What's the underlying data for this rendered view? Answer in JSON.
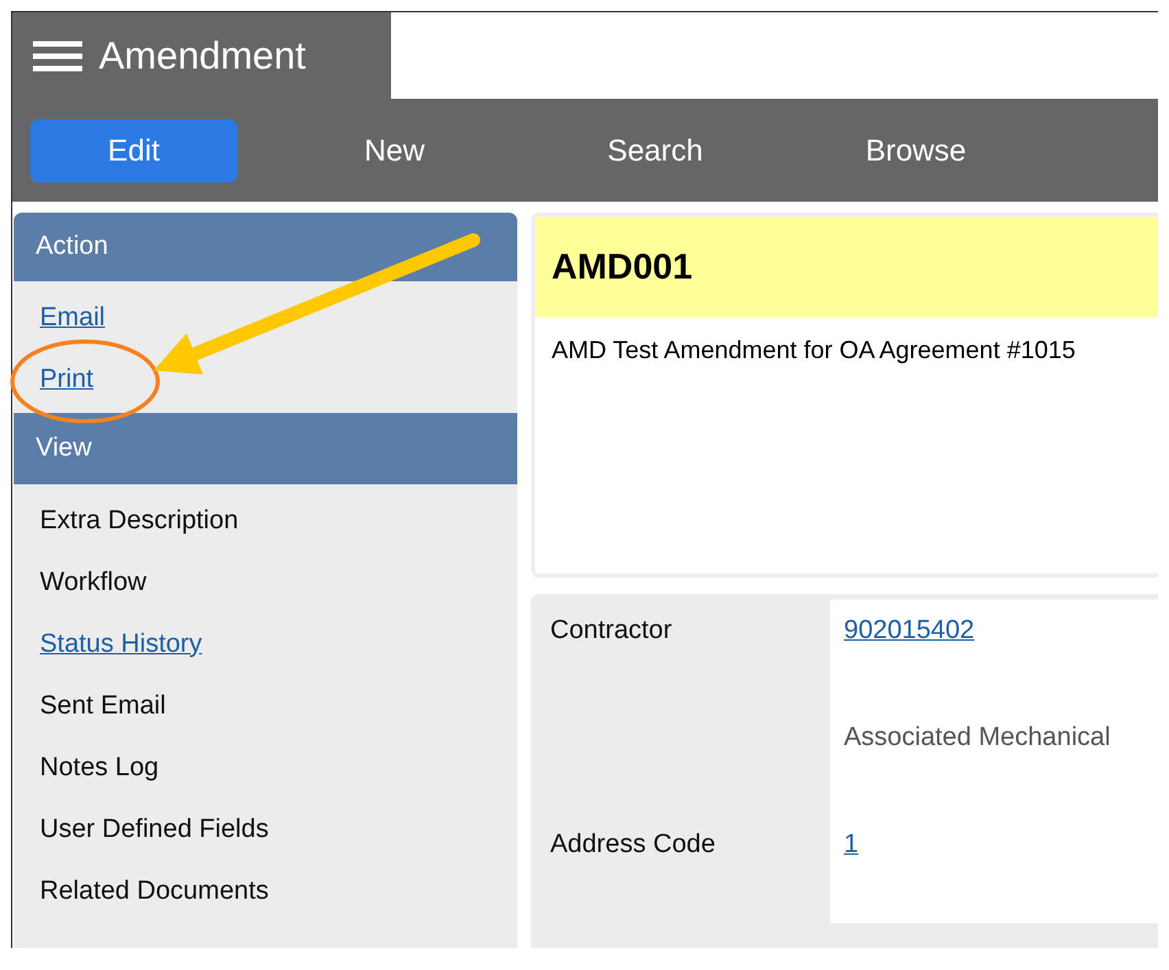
{
  "app": {
    "title": "Amendment"
  },
  "nav": [
    {
      "label": "Edit",
      "selected": true
    },
    {
      "label": "New",
      "selected": false
    },
    {
      "label": "Search",
      "selected": false
    },
    {
      "label": "Browse",
      "selected": false
    }
  ],
  "sidebar": {
    "sections": [
      {
        "title": "Action",
        "items": [
          {
            "label": "Email",
            "kind": "link"
          },
          {
            "label": "Print",
            "kind": "link"
          }
        ]
      },
      {
        "title": "View",
        "items": [
          {
            "label": "Extra Description",
            "kind": "text"
          },
          {
            "label": "Workflow",
            "kind": "text"
          },
          {
            "label": "Status History",
            "kind": "link"
          },
          {
            "label": "Sent Email",
            "kind": "text"
          },
          {
            "label": "Notes Log",
            "kind": "text"
          },
          {
            "label": "User Defined Fields",
            "kind": "text"
          },
          {
            "label": "Related Documents",
            "kind": "text"
          }
        ]
      }
    ]
  },
  "record": {
    "code": "AMD001",
    "description": "AMD Test Amendment for OA Agreement #1015"
  },
  "fields": [
    {
      "label": "Contractor",
      "value": "902015402",
      "kind": "link"
    },
    {
      "value": "Associated Mechanical",
      "kind": "text"
    },
    {
      "label": "Address Code",
      "value": "1",
      "kind": "link"
    }
  ]
}
